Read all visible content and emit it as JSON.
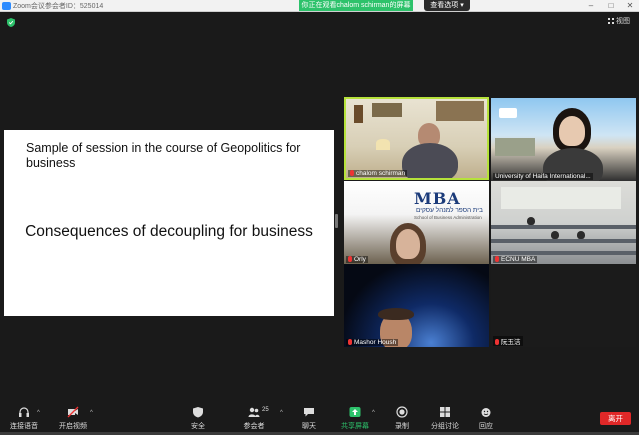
{
  "titlebar": {
    "title": "Zoom会议参会者ID：525014",
    "minimize": "–",
    "maximize": "□",
    "close": "✕"
  },
  "share_banner": "你正在观看chalom schirman的屏幕",
  "view_options": "查看选项 ▾",
  "view_button": "视图",
  "slide": {
    "title": "Sample of session in the course of Geopolitics for business",
    "heading": "Consequences of decoupling for business"
  },
  "participants": [
    {
      "name": "chalom schirman"
    },
    {
      "name": "University of Haifa International..."
    },
    {
      "name": "Orly"
    },
    {
      "name": "ECNU MBA"
    },
    {
      "name": "Mashor Housh"
    },
    {
      "name": "阮玉洁"
    }
  ],
  "mba_logo": {
    "text": "MBA",
    "hebrew": "בית הספר למנהל עסקים",
    "english": "School of Business Administration"
  },
  "toolbar": {
    "audio": "连接语音",
    "video": "开启视频",
    "security": "安全",
    "participants": "参会者",
    "participants_count": "25",
    "chat": "聊天",
    "share": "共享屏幕",
    "record": "录制",
    "breakout": "分组讨论",
    "reactions": "回应",
    "leave": "离开"
  },
  "colors": {
    "share_green": "#2dc26b",
    "leave_red": "#e02828",
    "active_border": "#b6e23b",
    "zoom_blue": "#2d8cff"
  }
}
